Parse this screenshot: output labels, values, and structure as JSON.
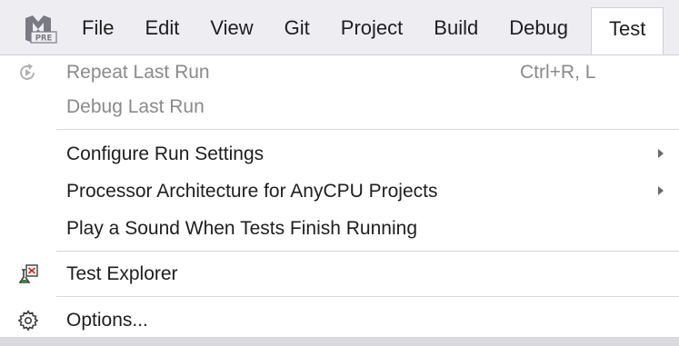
{
  "menubar": {
    "items": [
      {
        "label": "File"
      },
      {
        "label": "Edit"
      },
      {
        "label": "View"
      },
      {
        "label": "Git"
      },
      {
        "label": "Project"
      },
      {
        "label": "Build"
      },
      {
        "label": "Debug"
      },
      {
        "label": "Test"
      }
    ],
    "app_icon_badge": "PRE"
  },
  "test_menu": {
    "repeat_last_run": {
      "label": "Repeat Last Run",
      "shortcut": "Ctrl+R, L",
      "enabled": false
    },
    "debug_last_run": {
      "label": "Debug Last Run",
      "enabled": false
    },
    "configure_run_settings": {
      "label": "Configure Run Settings",
      "has_submenu": true
    },
    "processor_architecture": {
      "label": "Processor Architecture for AnyCPU Projects",
      "has_submenu": true
    },
    "play_sound": {
      "label": "Play a Sound When Tests Finish Running"
    },
    "test_explorer": {
      "label": "Test Explorer",
      "icon": "test-explorer-icon"
    },
    "options": {
      "label": "Options...",
      "icon": "gear-icon"
    }
  }
}
